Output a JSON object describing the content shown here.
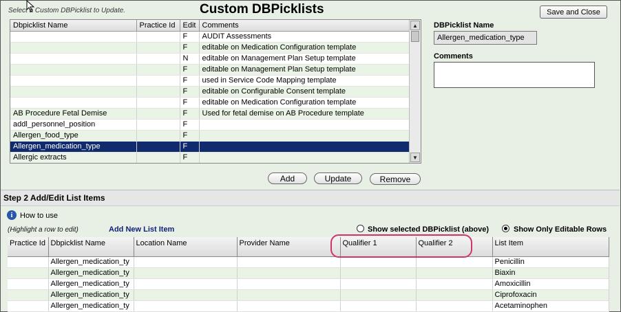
{
  "header": {
    "instruction": "Select a Custom DBPicklist to Update.",
    "title": "Custom DBPicklists",
    "save_close_label": "Save and Close"
  },
  "picklist_table": {
    "columns": [
      "Dbpicklist Name",
      "Practice Id",
      "Edit",
      "Comments"
    ],
    "rows": [
      {
        "name": "",
        "practice_id": "",
        "edit": "F",
        "comments": "AUDIT Assessments"
      },
      {
        "name": "",
        "practice_id": "",
        "edit": "F",
        "comments": "editable on Medication Configuration template"
      },
      {
        "name": "",
        "practice_id": "",
        "edit": "N",
        "comments": "editable on  Management Plan Setup template"
      },
      {
        "name": "",
        "practice_id": "",
        "edit": "F",
        "comments": "editable on Management Plan Setup template"
      },
      {
        "name": "",
        "practice_id": "",
        "edit": "F",
        "comments": "used in Service Code Mapping template"
      },
      {
        "name": "",
        "practice_id": "",
        "edit": "F",
        "comments": "editable on Configurable Consent template"
      },
      {
        "name": "",
        "practice_id": "",
        "edit": "F",
        "comments": "editable on Medication Configuration template"
      },
      {
        "name": "AB Procedure Fetal Demise",
        "practice_id": "",
        "edit": "F",
        "comments": "Used for fetal demise on AB Procedure template"
      },
      {
        "name": "addl_personnel_position",
        "practice_id": "",
        "edit": "F",
        "comments": ""
      },
      {
        "name": "Allergen_food_type",
        "practice_id": "",
        "edit": "F",
        "comments": ""
      },
      {
        "name": "Allergen_medication_type",
        "practice_id": "",
        "edit": "F",
        "comments": ""
      },
      {
        "name": "Allergic extracts",
        "practice_id": "",
        "edit": "F",
        "comments": ""
      }
    ],
    "selected_index": 10
  },
  "details": {
    "name_label": "DBPicklist Name",
    "name_value": "Allergen_medication_type",
    "comments_label": "Comments",
    "comments_value": ""
  },
  "actions": {
    "add_label": "Add",
    "update_label": "Update",
    "remove_label": "Remove"
  },
  "step2": {
    "title": "Step 2 Add/Edit List Items",
    "how_to_use": "How to use",
    "hint": "(Highlight a row to edit)",
    "add_new_label": "Add New List Item",
    "radio_selected_label": "Show selected DBPicklist (above)",
    "radio_editable_label": "Show Only Editable Rows",
    "radio_selected_on": false,
    "radio_editable_on": true,
    "columns": [
      "Practice Id",
      "Dbpicklist Name",
      "Location Name",
      "Provider Name",
      "Qualifier 1",
      "Qualifier 2",
      "List Item"
    ],
    "rows": [
      {
        "practice_id": "",
        "picklist": "Allergen_medication_ty",
        "location": "",
        "provider": "",
        "q1": "",
        "q2": "",
        "item": "Penicillin"
      },
      {
        "practice_id": "",
        "picklist": "Allergen_medication_ty",
        "location": "",
        "provider": "",
        "q1": "",
        "q2": "",
        "item": "Biaxin"
      },
      {
        "practice_id": "",
        "picklist": "Allergen_medication_ty",
        "location": "",
        "provider": "",
        "q1": "",
        "q2": "",
        "item": "Amoxicillin"
      },
      {
        "practice_id": "",
        "picklist": "Allergen_medication_ty",
        "location": "",
        "provider": "",
        "q1": "",
        "q2": "",
        "item": "Ciprofoxacin"
      },
      {
        "practice_id": "",
        "picklist": "Allergen_medication_ty",
        "location": "",
        "provider": "",
        "q1": "",
        "q2": "",
        "item": "Acetaminophen"
      }
    ]
  },
  "colors": {
    "selection": "#0f2b6e",
    "alt_row": "#e9f3e6",
    "highlight_oval": "#d0336c",
    "link": "#0d1f7a"
  }
}
